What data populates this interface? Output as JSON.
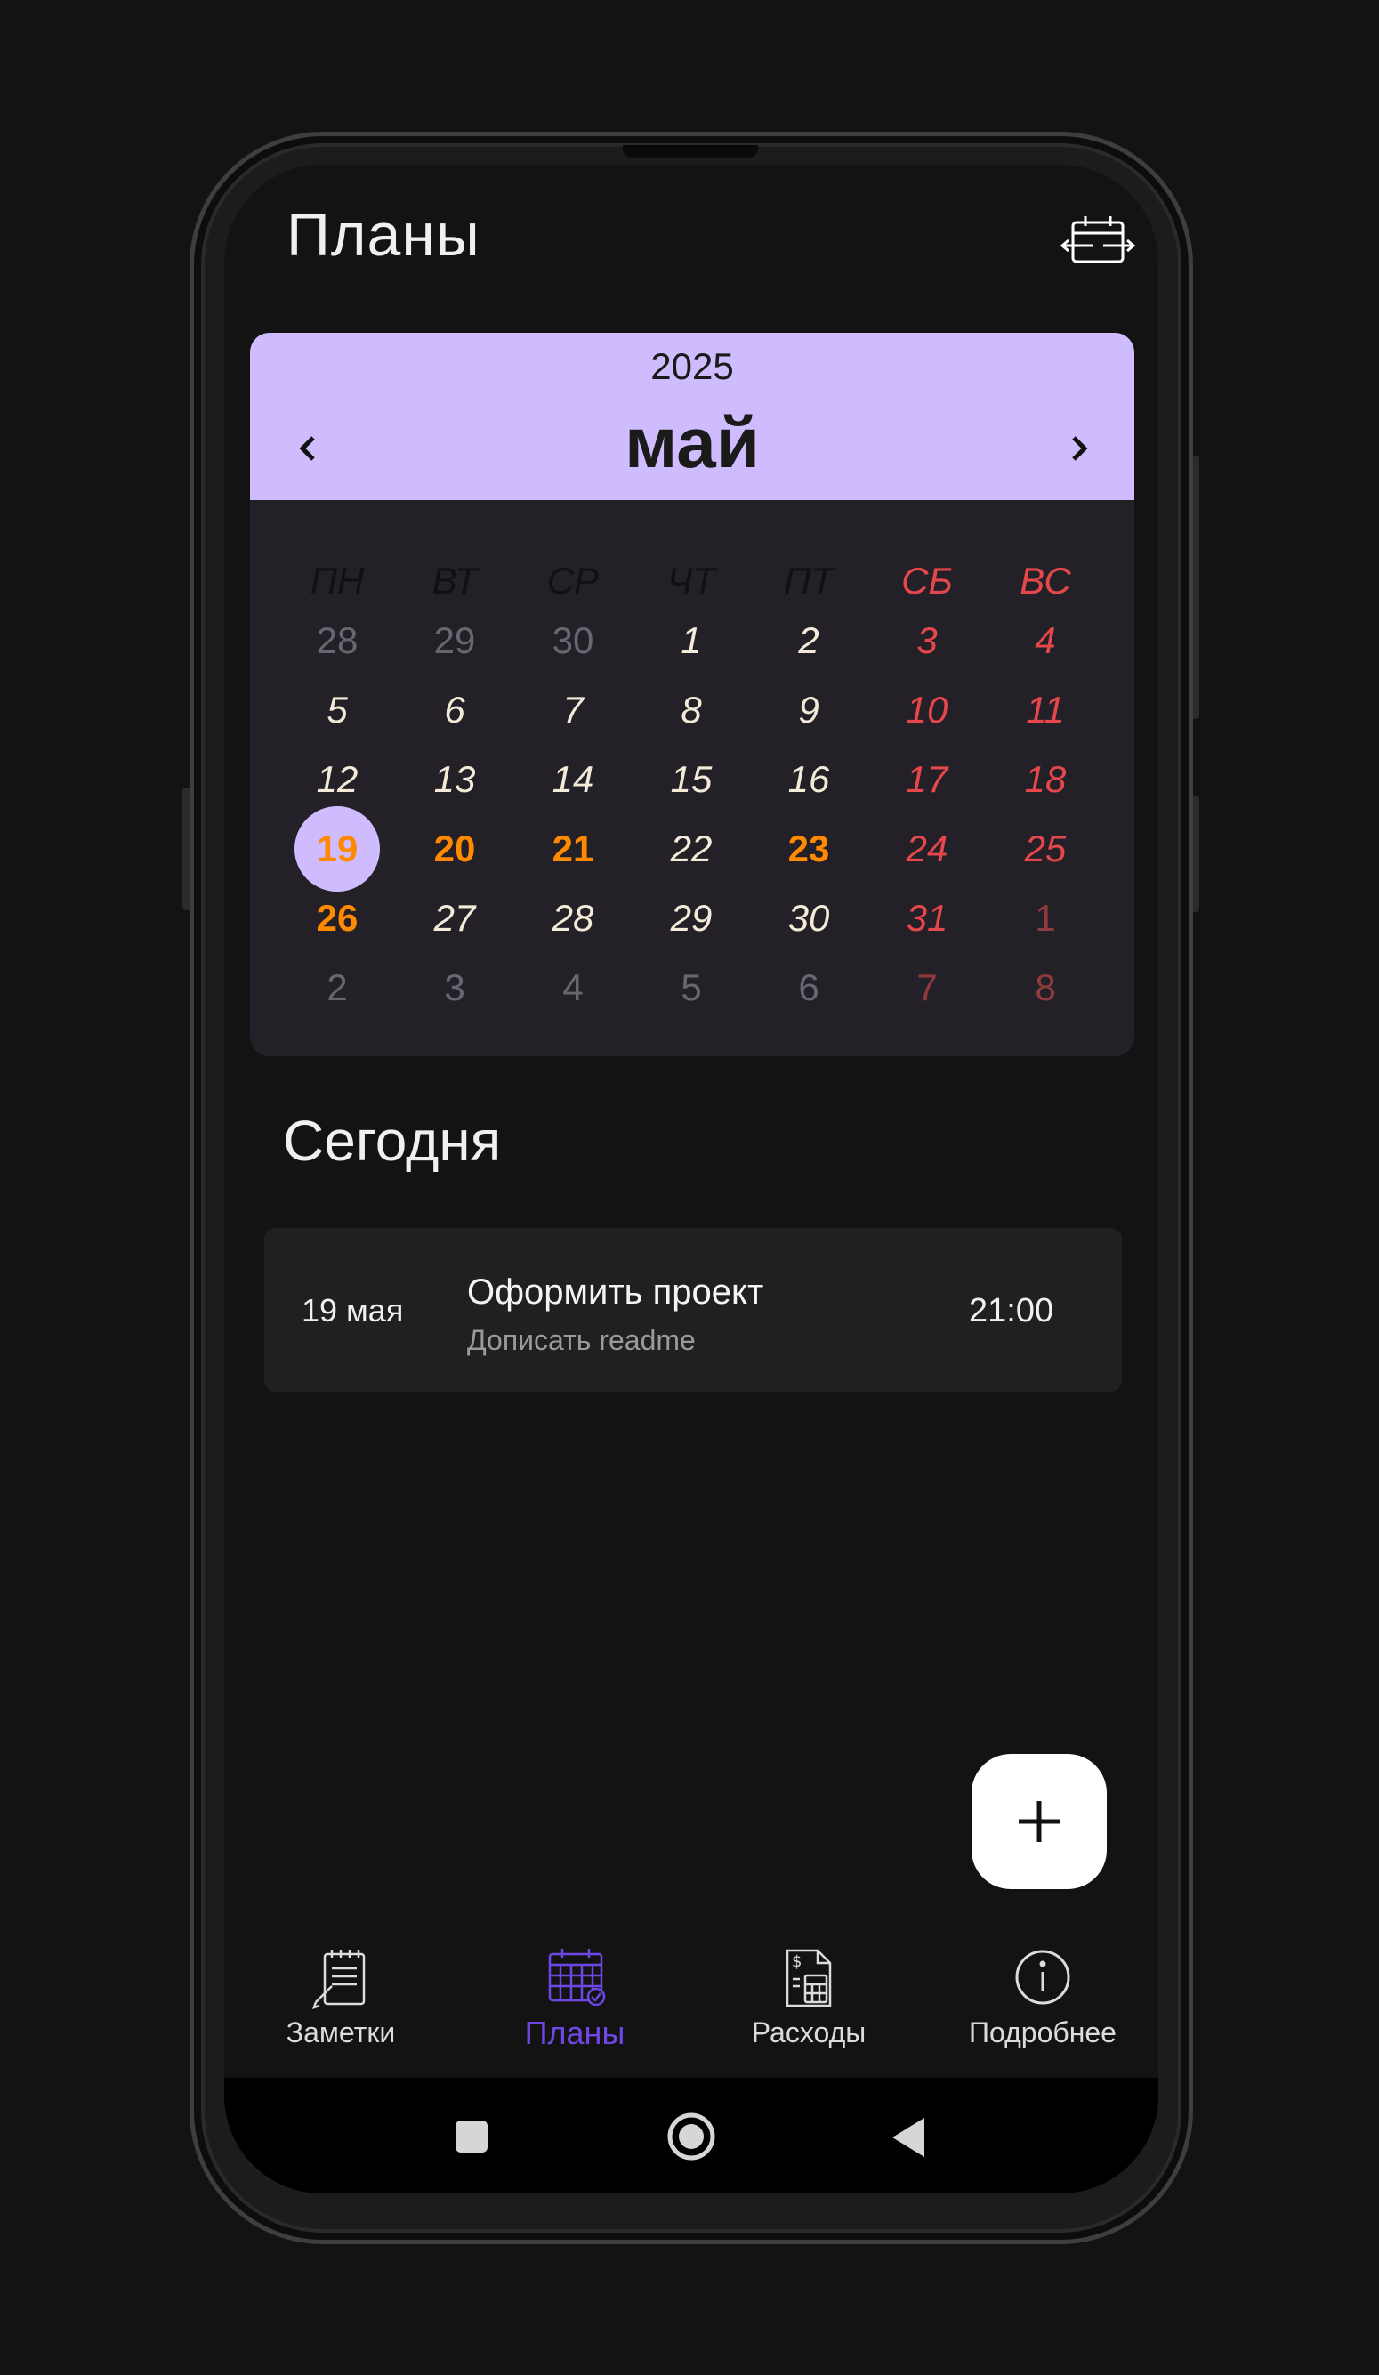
{
  "header": {
    "title": "Планы",
    "icon": "calendar-swap-icon"
  },
  "calendar": {
    "year": "2025",
    "month": "май",
    "weekdays": [
      "ПН",
      "ВТ",
      "СР",
      "ЧТ",
      "ПТ",
      "СБ",
      "ВС"
    ],
    "weeks": [
      [
        {
          "d": "28",
          "t": "muted"
        },
        {
          "d": "29",
          "t": "muted"
        },
        {
          "d": "30",
          "t": "muted"
        },
        {
          "d": "1",
          "t": "normal"
        },
        {
          "d": "2",
          "t": "normal"
        },
        {
          "d": "3",
          "t": "weekend"
        },
        {
          "d": "4",
          "t": "weekend"
        }
      ],
      [
        {
          "d": "5",
          "t": "normal"
        },
        {
          "d": "6",
          "t": "normal"
        },
        {
          "d": "7",
          "t": "normal"
        },
        {
          "d": "8",
          "t": "normal"
        },
        {
          "d": "9",
          "t": "normal"
        },
        {
          "d": "10",
          "t": "weekend"
        },
        {
          "d": "11",
          "t": "weekend"
        }
      ],
      [
        {
          "d": "12",
          "t": "normal"
        },
        {
          "d": "13",
          "t": "normal"
        },
        {
          "d": "14",
          "t": "normal"
        },
        {
          "d": "15",
          "t": "normal"
        },
        {
          "d": "16",
          "t": "normal"
        },
        {
          "d": "17",
          "t": "weekend"
        },
        {
          "d": "18",
          "t": "weekend"
        }
      ],
      [
        {
          "d": "19",
          "t": "today"
        },
        {
          "d": "20",
          "t": "event"
        },
        {
          "d": "21",
          "t": "event"
        },
        {
          "d": "22",
          "t": "normal"
        },
        {
          "d": "23",
          "t": "event"
        },
        {
          "d": "24",
          "t": "weekend"
        },
        {
          "d": "25",
          "t": "weekend"
        }
      ],
      [
        {
          "d": "26",
          "t": "event"
        },
        {
          "d": "27",
          "t": "normal"
        },
        {
          "d": "28",
          "t": "normal"
        },
        {
          "d": "29",
          "t": "normal"
        },
        {
          "d": "30",
          "t": "normal"
        },
        {
          "d": "31",
          "t": "weekend"
        },
        {
          "d": "1",
          "t": "muted-weekend"
        }
      ],
      [
        {
          "d": "2",
          "t": "muted"
        },
        {
          "d": "3",
          "t": "muted"
        },
        {
          "d": "4",
          "t": "muted"
        },
        {
          "d": "5",
          "t": "muted"
        },
        {
          "d": "6",
          "t": "muted"
        },
        {
          "d": "7",
          "t": "muted-weekend"
        },
        {
          "d": "8",
          "t": "muted-weekend"
        }
      ]
    ]
  },
  "today": {
    "title": "Сегодня",
    "tasks": [
      {
        "date": "19 мая",
        "title": "Оформить проект",
        "subtitle": "Дописать readme",
        "time": "21:00"
      }
    ]
  },
  "nav": {
    "items": [
      {
        "label": "Заметки",
        "icon": "notepad-icon",
        "active": false
      },
      {
        "label": "Планы",
        "icon": "calendar-icon",
        "active": true
      },
      {
        "label": "Расходы",
        "icon": "invoice-calculator-icon",
        "active": false
      },
      {
        "label": "Подробнее",
        "icon": "info-icon",
        "active": false
      }
    ]
  },
  "colors": {
    "accent": "#cfbcfe",
    "active_nav": "#6e47e5",
    "event": "#ff8a00",
    "weekend": "#e5474b",
    "background": "#131313"
  }
}
